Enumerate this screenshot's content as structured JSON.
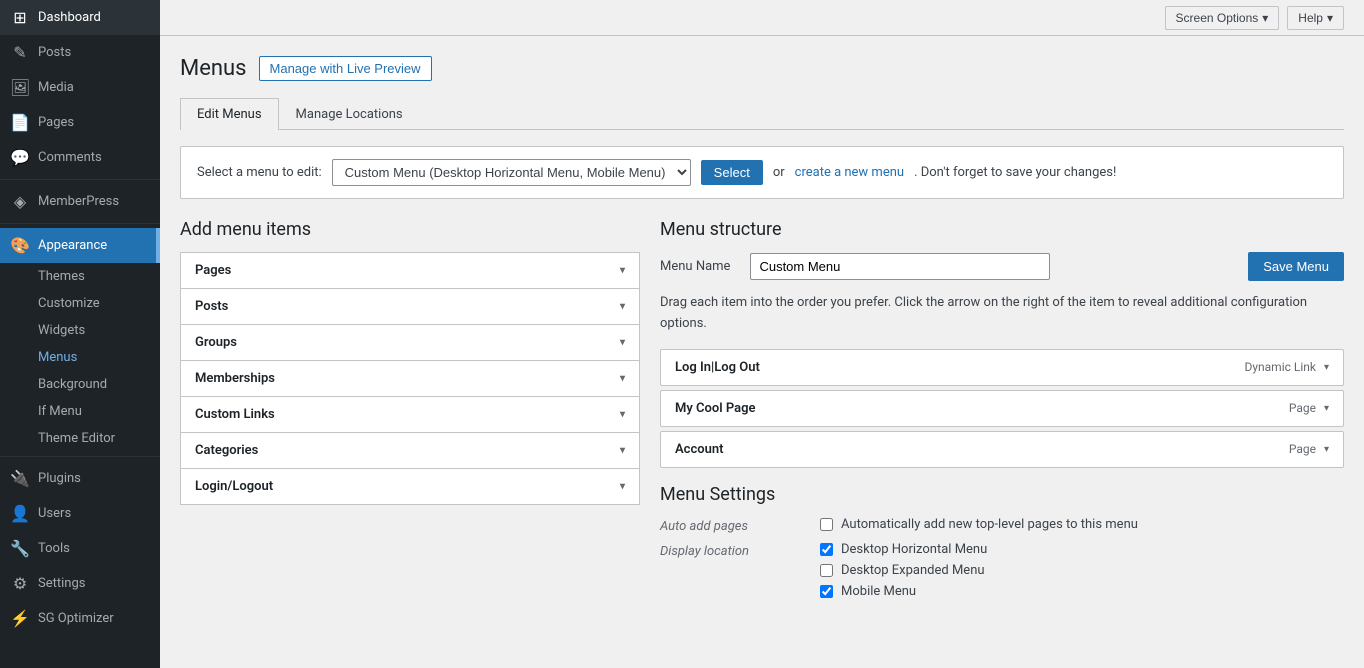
{
  "topbar": {
    "screen_options_label": "Screen Options",
    "help_label": "Help"
  },
  "sidebar": {
    "items": [
      {
        "id": "dashboard",
        "label": "Dashboard",
        "icon": "⊞"
      },
      {
        "id": "posts",
        "label": "Posts",
        "icon": "✎"
      },
      {
        "id": "media",
        "label": "Media",
        "icon": "🖼"
      },
      {
        "id": "pages",
        "label": "Pages",
        "icon": "📄"
      },
      {
        "id": "comments",
        "label": "Comments",
        "icon": "💬"
      },
      {
        "id": "memberpress",
        "label": "MemberPress",
        "icon": "◈"
      },
      {
        "id": "appearance",
        "label": "Appearance",
        "icon": "🎨",
        "active": true
      },
      {
        "id": "plugins",
        "label": "Plugins",
        "icon": "🔌"
      },
      {
        "id": "users",
        "label": "Users",
        "icon": "👤"
      },
      {
        "id": "tools",
        "label": "Tools",
        "icon": "🔧"
      },
      {
        "id": "settings",
        "label": "Settings",
        "icon": "⚙"
      },
      {
        "id": "sg-optimizer",
        "label": "SG Optimizer",
        "icon": "⚡"
      }
    ],
    "appearance_sub": [
      {
        "id": "themes",
        "label": "Themes"
      },
      {
        "id": "customize",
        "label": "Customize"
      },
      {
        "id": "widgets",
        "label": "Widgets"
      },
      {
        "id": "menus",
        "label": "Menus",
        "active": true
      },
      {
        "id": "background",
        "label": "Background"
      },
      {
        "id": "if-menu",
        "label": "If Menu"
      },
      {
        "id": "theme-editor",
        "label": "Theme Editor"
      }
    ]
  },
  "page": {
    "title": "Menus",
    "live_preview_btn": "Manage with Live Preview",
    "tabs": [
      {
        "id": "edit-menus",
        "label": "Edit Menus",
        "active": true
      },
      {
        "id": "manage-locations",
        "label": "Manage Locations"
      }
    ],
    "select_row": {
      "label": "Select a menu to edit:",
      "selected_option": "Custom Menu (Desktop Horizontal Menu, Mobile Menu)",
      "select_btn": "Select",
      "or_text": "or",
      "create_link": "create a new menu",
      "dont_forget": ". Don't forget to save your changes!"
    }
  },
  "add_menu_items": {
    "title": "Add menu items",
    "accordion_items": [
      {
        "id": "pages",
        "label": "Pages"
      },
      {
        "id": "posts",
        "label": "Posts"
      },
      {
        "id": "groups",
        "label": "Groups"
      },
      {
        "id": "memberships",
        "label": "Memberships"
      },
      {
        "id": "custom-links",
        "label": "Custom Links"
      },
      {
        "id": "categories",
        "label": "Categories"
      },
      {
        "id": "login-logout",
        "label": "Login/Logout"
      }
    ]
  },
  "menu_structure": {
    "title": "Menu structure",
    "menu_name_label": "Menu Name",
    "menu_name_value": "Custom Menu",
    "save_menu_btn": "Save Menu",
    "drag_instruction": "Drag each item into the order you prefer. Click the arrow on the right of the item to reveal additional configuration options.",
    "menu_items": [
      {
        "id": "log-in-out",
        "label": "Log In|Log Out",
        "type": "Dynamic Link"
      },
      {
        "id": "my-cool-page",
        "label": "My Cool Page",
        "type": "Page"
      },
      {
        "id": "account",
        "label": "Account",
        "type": "Page"
      }
    ]
  },
  "menu_settings": {
    "title": "Menu Settings",
    "auto_add_label": "Auto add pages",
    "auto_add_checkbox": "Automatically add new top-level pages to this menu",
    "auto_add_checked": false,
    "display_location_label": "Display location",
    "locations": [
      {
        "id": "desktop-horizontal",
        "label": "Desktop Horizontal Menu",
        "checked": true
      },
      {
        "id": "desktop-expanded",
        "label": "Desktop Expanded Menu",
        "checked": false
      },
      {
        "id": "mobile-menu",
        "label": "Mobile Menu",
        "checked": true
      }
    ]
  }
}
